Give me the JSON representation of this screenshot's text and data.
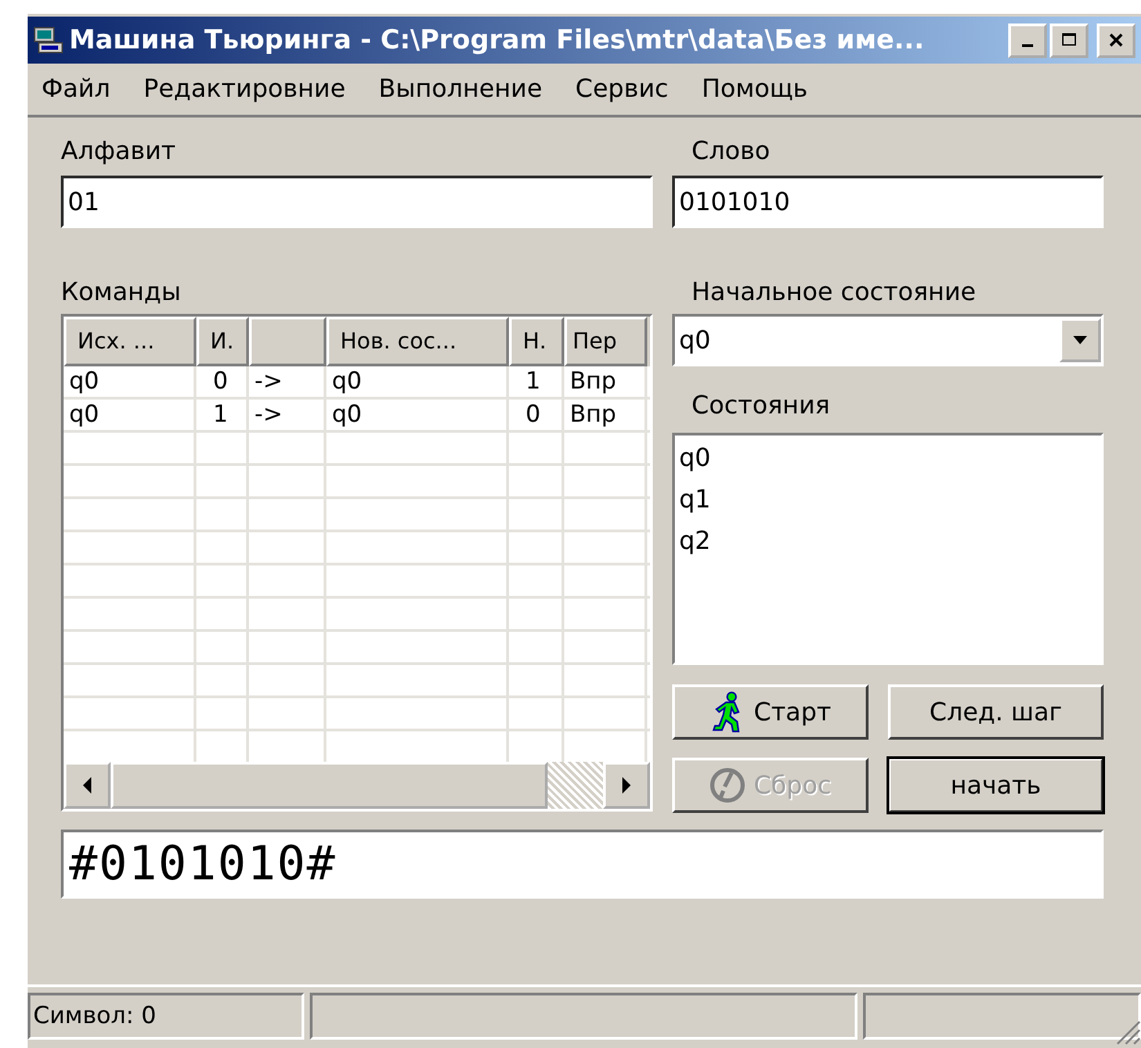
{
  "window": {
    "title": "Машина Тьюринга - C:\\Program Files\\mtr\\data\\Без име..."
  },
  "menu": [
    {
      "label": "Файл"
    },
    {
      "label": "Редактировние"
    },
    {
      "label": "Выполнение"
    },
    {
      "label": "Сервис"
    },
    {
      "label": "Помощь"
    }
  ],
  "alphabet": {
    "label": "Алфавит",
    "value": "01"
  },
  "word": {
    "label": "Слово",
    "value": "0101010"
  },
  "commands": {
    "label": "Команды",
    "columns": [
      "Исх. ...",
      "И.",
      "",
      "Нов. сос...",
      "Н.",
      "Пер"
    ],
    "rows": [
      [
        "q0",
        "0",
        "->",
        "q0",
        "1",
        "Впр"
      ],
      [
        "q0",
        "1",
        "->",
        "q0",
        "0",
        "Впр"
      ]
    ]
  },
  "initial_state": {
    "label": "Начальное состояние",
    "value": "q0"
  },
  "states": {
    "label": "Состояния",
    "items": [
      {
        "label": "q0",
        "selected": false
      },
      {
        "label": "q1",
        "selected": false
      },
      {
        "label": "q2",
        "selected": false
      }
    ]
  },
  "buttons": [
    {
      "label": "Старт",
      "kind": "start",
      "disabled": false,
      "default": false
    },
    {
      "label": "След. шаг",
      "kind": "plain",
      "disabled": false,
      "default": false
    },
    {
      "label": "Сброс",
      "kind": "reset",
      "disabled": true,
      "default": false
    },
    {
      "label": "начать",
      "kind": "plain",
      "disabled": false,
      "default": true
    }
  ],
  "tape": {
    "value": "#0101010#"
  },
  "status_bar": {
    "symbol": "Символ: 0"
  }
}
